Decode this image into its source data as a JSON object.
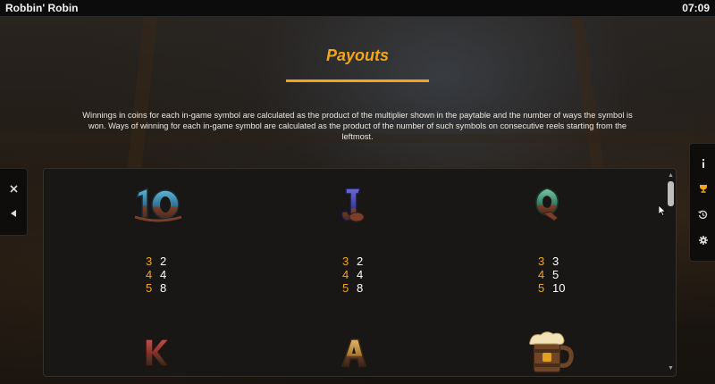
{
  "window": {
    "title": "Robbin' Robin",
    "clock": "07:09"
  },
  "page": {
    "heading": "Payouts",
    "description": "Winnings in coins for each in-game symbol are calculated as the product of the multiplier shown in the paytable and the number of ways the symbol is won. Ways of winning for each in-game symbol are calculated as the product of the number of such symbols on consecutive reels starting from the leftmost."
  },
  "left_controls": [
    "close-icon",
    "back-arrow-icon"
  ],
  "right_controls": [
    "info-icon",
    "trophy-icon",
    "history-icon",
    "settings-icon"
  ],
  "accent_color": "#f2a51c",
  "symbols": [
    {
      "name": "10",
      "pays": [
        {
          "count": "3",
          "value": "2"
        },
        {
          "count": "4",
          "value": "4"
        },
        {
          "count": "5",
          "value": "8"
        }
      ]
    },
    {
      "name": "J",
      "pays": [
        {
          "count": "3",
          "value": "2"
        },
        {
          "count": "4",
          "value": "4"
        },
        {
          "count": "5",
          "value": "8"
        }
      ]
    },
    {
      "name": "Q",
      "pays": [
        {
          "count": "3",
          "value": "3"
        },
        {
          "count": "4",
          "value": "5"
        },
        {
          "count": "5",
          "value": "10"
        }
      ]
    },
    {
      "name": "K"
    },
    {
      "name": "A"
    },
    {
      "name": "tankard"
    }
  ]
}
